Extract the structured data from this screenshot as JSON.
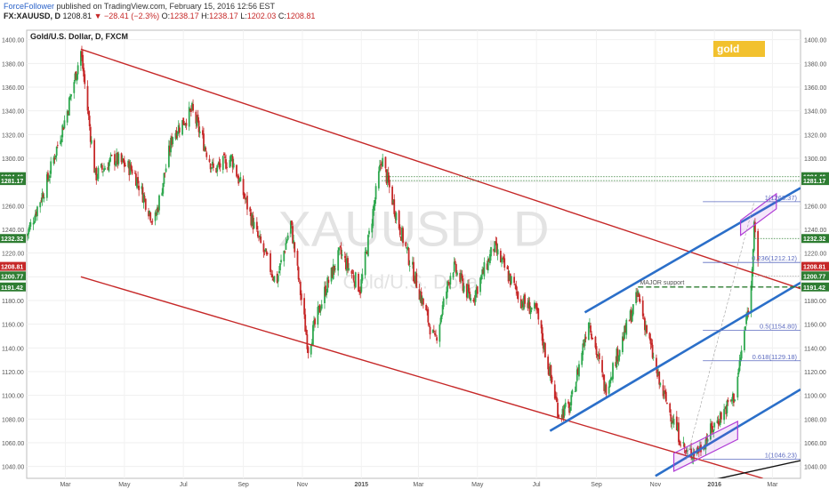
{
  "publisher": {
    "author": "ForceFollower",
    "text": "published on TradingView.com, February 15, 2016 12:56 EST"
  },
  "ohlc_line": {
    "symbol": "FX:XAUUSD, D",
    "last": "1208.81",
    "arrow": "▼",
    "change": "−28.41 (−2.3%)",
    "o_label": "O:",
    "o": "1238.17",
    "h_label": "H:",
    "h": "1238.17",
    "l_label": "L:",
    "l": "1202.03",
    "c_label": "C:",
    "c": "1208.81"
  },
  "colors": {
    "up": "#2fa84f",
    "down": "#c62828",
    "red_channel": "#c62828",
    "blue_channel": "#2b6fc9",
    "fib": "#5c6bc0",
    "purple_box": "#b03dd6",
    "gold_badge": "#f2c12e",
    "green_dashed": "#2e7d32",
    "watermark": "#e3e3e3"
  },
  "chart_data": {
    "type": "candlestick",
    "title": "Gold/U.S. Dollar, D, FXCM",
    "watermark": "XAUUSD, D",
    "watermark_sub": "Gold/U.S. Dollar",
    "badge": "gold",
    "ylim": [
      1030,
      1408
    ],
    "y_ticks": [
      1040,
      1060,
      1080,
      1100,
      1120,
      1140,
      1160,
      1180,
      1200,
      1220,
      1240,
      1260,
      1280,
      1300,
      1320,
      1340,
      1360,
      1380,
      1400
    ],
    "y_tick_labels": [
      "1040.00",
      "1060.00",
      "1080.00",
      "1100.00",
      "1120.00",
      "1140.00",
      "1160.00",
      "1180.00",
      "1200.00",
      "1220.00",
      "1240.00",
      "1260.00",
      "1280.00",
      "1300.00",
      "1320.00",
      "1340.00",
      "1360.00",
      "1380.00",
      "1400.00"
    ],
    "x_ticks": [
      {
        "label": "Mar",
        "date": "2014-03-01"
      },
      {
        "label": "May",
        "date": "2014-05-01"
      },
      {
        "label": "Jul",
        "date": "2014-07-01"
      },
      {
        "label": "Sep",
        "date": "2014-09-01"
      },
      {
        "label": "Nov",
        "date": "2014-11-01"
      },
      {
        "label": "2015",
        "date": "2015-01-01"
      },
      {
        "label": "Mar",
        "date": "2015-03-01"
      },
      {
        "label": "May",
        "date": "2015-05-01"
      },
      {
        "label": "Jul",
        "date": "2015-07-01"
      },
      {
        "label": "Sep",
        "date": "2015-09-01"
      },
      {
        "label": "Nov",
        "date": "2015-11-01"
      },
      {
        "label": "2016",
        "date": "2016-01-01"
      },
      {
        "label": "Mar",
        "date": "2016-03-01"
      }
    ],
    "price_path": [
      [
        "2014-01-20",
        1235
      ],
      [
        "2014-02-10",
        1280
      ],
      [
        "2014-03-03",
        1340
      ],
      [
        "2014-03-17",
        1390
      ],
      [
        "2014-04-01",
        1285
      ],
      [
        "2014-04-20",
        1300
      ],
      [
        "2014-05-10",
        1290
      ],
      [
        "2014-06-01",
        1245
      ],
      [
        "2014-06-20",
        1320
      ],
      [
        "2014-07-10",
        1340
      ],
      [
        "2014-08-01",
        1290
      ],
      [
        "2014-08-20",
        1300
      ],
      [
        "2014-09-15",
        1235
      ],
      [
        "2014-10-05",
        1195
      ],
      [
        "2014-10-20",
        1245
      ],
      [
        "2014-11-07",
        1140
      ],
      [
        "2014-11-25",
        1190
      ],
      [
        "2014-12-10",
        1220
      ],
      [
        "2014-12-31",
        1190
      ],
      [
        "2015-01-22",
        1300
      ],
      [
        "2015-02-10",
        1240
      ],
      [
        "2015-03-18",
        1145
      ],
      [
        "2015-04-05",
        1210
      ],
      [
        "2015-04-25",
        1180
      ],
      [
        "2015-05-18",
        1225
      ],
      [
        "2015-06-15",
        1180
      ],
      [
        "2015-07-01",
        1170
      ],
      [
        "2015-07-24",
        1085
      ],
      [
        "2015-08-05",
        1090
      ],
      [
        "2015-08-24",
        1165
      ],
      [
        "2015-09-10",
        1105
      ],
      [
        "2015-10-14",
        1185
      ],
      [
        "2015-11-05",
        1110
      ],
      [
        "2015-12-03",
        1050
      ],
      [
        "2015-12-17",
        1055
      ],
      [
        "2016-01-05",
        1080
      ],
      [
        "2016-01-22",
        1100
      ],
      [
        "2016-02-08",
        1190
      ],
      [
        "2016-02-11",
        1250
      ],
      [
        "2016-02-15",
        1208
      ]
    ],
    "price_labels": [
      {
        "value": 1284.46,
        "label": "1284.46",
        "color": "#2e7d32"
      },
      {
        "value": 1281.17,
        "label": "1281.17",
        "color": "#2e7d32"
      },
      {
        "value": 1232.32,
        "label": "1232.32",
        "color": "#2e7d32"
      },
      {
        "value": 1208.81,
        "label": "1208.81",
        "color": "#c62828"
      },
      {
        "value": 1200.77,
        "label": "1200.77",
        "color": "#2e7d32"
      },
      {
        "value": 1191.42,
        "label": "1191.42",
        "color": "#2e7d32"
      }
    ],
    "fib_levels": [
      {
        "value": 1263.37,
        "label": "1(1263.37)"
      },
      {
        "value": 1212.12,
        "label": "0.236(1212.12)"
      },
      {
        "value": 1154.8,
        "label": "0.5(1154.80)"
      },
      {
        "value": 1129.18,
        "label": "0.618(1129.18)"
      },
      {
        "value": 1046.23,
        "label": "1(1046.23)"
      }
    ],
    "annotations": [
      {
        "label": "MAJOR support",
        "value": 1191.42
      }
    ],
    "red_channel": {
      "upper": [
        [
          "2014-03-17",
          1392
        ],
        [
          "2016-03-30",
          1190
        ]
      ],
      "lower": [
        [
          "2014-03-17",
          1200
        ],
        [
          "2016-02-20",
          1030
        ]
      ]
    },
    "blue_channel": {
      "upper": [
        [
          "2015-08-20",
          1170
        ],
        [
          "2016-03-30",
          1275
        ]
      ],
      "middle": [
        [
          "2015-07-15",
          1070
        ],
        [
          "2016-03-30",
          1195
        ]
      ],
      "lower": [
        [
          "2015-11-01",
          1032
        ],
        [
          "2016-03-30",
          1105
        ]
      ]
    },
    "purple_boxes": [
      {
        "from": "2015-11-20",
        "to": "2016-01-25",
        "low": 1036,
        "high": 1078
      },
      {
        "from": "2016-01-28",
        "to": "2016-03-05",
        "low": 1235,
        "high": 1270
      }
    ],
    "black_line": [
      [
        "2016-01-01",
        1029
      ],
      [
        "2016-03-30",
        1045
      ]
    ]
  }
}
